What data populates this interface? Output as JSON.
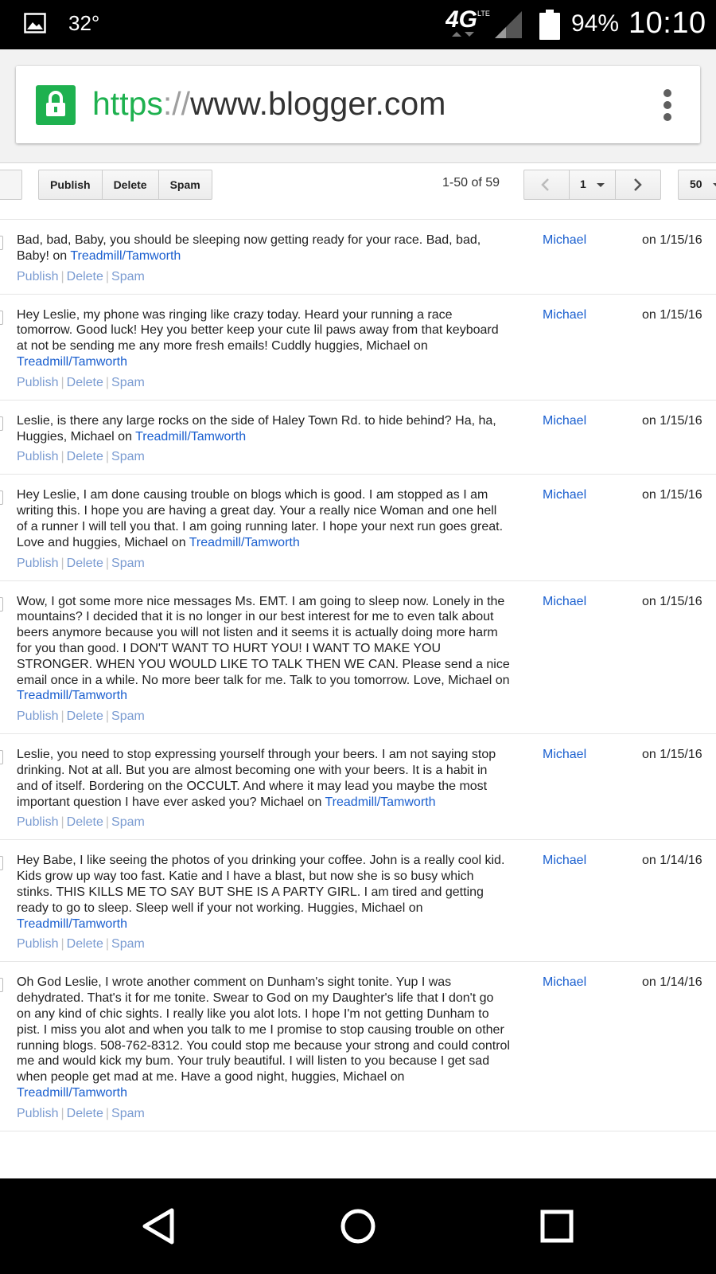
{
  "status_bar": {
    "temperature": "32°",
    "network": "4G LTE",
    "battery_percent": "94%",
    "time": "10:10",
    "icons": [
      "image-icon",
      "network-4g-icon",
      "signal-icon",
      "battery-icon"
    ]
  },
  "browser": {
    "url_scheme": "https",
    "url_separator": "://",
    "url_host": "www.blogger.com",
    "secure_color": "#1eb14f"
  },
  "toolbar": {
    "publish_label": "Publish",
    "delete_label": "Delete",
    "spam_label": "Spam",
    "range_text": "1-50 of 59",
    "page_number": "1",
    "per_page": "50"
  },
  "actions": {
    "publish": "Publish",
    "delete": "Delete",
    "spam": "Spam",
    "separator": "|"
  },
  "comments": [
    {
      "text": "Bad, bad, Baby, you should be sleeping now getting ready for your race. Bad, bad, Baby! on ",
      "post": "Treadmill/Tamworth",
      "author": "Michael",
      "date": "on 1/15/16"
    },
    {
      "text": "Hey Leslie, my phone was ringing like crazy today. Heard your running a race tomorrow. Good luck! Hey you better keep your cute lil paws away from that keyboard at not be sending me any more fresh emails! Cuddly huggies, Michael on ",
      "post": "Treadmill/Tamworth",
      "author": "Michael",
      "date": "on 1/15/16"
    },
    {
      "text": "Leslie, is there any large rocks on the side of Haley Town Rd. to hide behind? Ha, ha, Huggies, Michael on ",
      "post": "Treadmill/Tamworth",
      "author": "Michael",
      "date": "on 1/15/16"
    },
    {
      "text": "Hey Leslie, I am done causing trouble on blogs which is good. I am stopped as I am writing this. I hope you are having a great day. Your a really nice Woman and one hell of a runner I will tell you that. I am going running later. I hope your next run goes great. Love and huggies, Michael on ",
      "post": "Treadmill/Tamworth",
      "author": "Michael",
      "date": "on 1/15/16"
    },
    {
      "text": "Wow, I got some more nice messages Ms. EMT. I am going to sleep now. Lonely in the mountains? I decided that it is no longer in our best interest for me to even talk about beers anymore because you will not listen and it seems it is actually doing more harm for you than good. I DON'T WANT TO HURT YOU! I WANT TO MAKE YOU STRONGER. WHEN YOU WOULD LIKE TO TALK THEN WE CAN. Please send a nice email once in a while. No more beer talk for me. Talk to you tomorrow. Love, Michael on ",
      "post": "Treadmill/Tamworth",
      "author": "Michael",
      "date": "on 1/15/16"
    },
    {
      "text": "Leslie, you need to stop expressing yourself through your beers. I am not saying stop drinking. Not at all. But you are almost becoming one with your beers. It is a habit in and of itself. Bordering on the OCCULT. And where it may lead you maybe the most important question I have ever asked you? Michael on ",
      "post": "Treadmill/Tamworth",
      "author": "Michael",
      "date": "on 1/15/16"
    },
    {
      "text": "Hey Babe, I like seeing the photos of you drinking your coffee. John is a really cool kid. Kids grow up way too fast. Katie and I have a blast, but now she is so busy which stinks. THIS KILLS ME TO SAY BUT SHE IS A PARTY GIRL. I am tired and getting ready to go to sleep. Sleep well if your not working. Huggies, Michael on ",
      "post": "Treadmill/Tamworth",
      "author": "Michael",
      "date": "on 1/14/16"
    },
    {
      "text": "Oh God Leslie, I wrote another comment on Dunham's sight tonite. Yup I was dehydrated. That's it for me tonite. Swear to God on my Daughter's life that I don't go on any kind of chic sights. I really like you alot lots. I hope I'm not getting Dunham to pist. I miss you alot and when you talk to me I promise to stop causing trouble on other running blogs. 508-762-8312. You could stop me because your strong and could control me and would kick my bum. Your truly beautiful. I will listen to you because I get sad when people get mad at me. Have a good night, huggies, Michael on ",
      "post": "Treadmill/Tamworth",
      "author": "Michael",
      "date": "on 1/14/16"
    }
  ]
}
